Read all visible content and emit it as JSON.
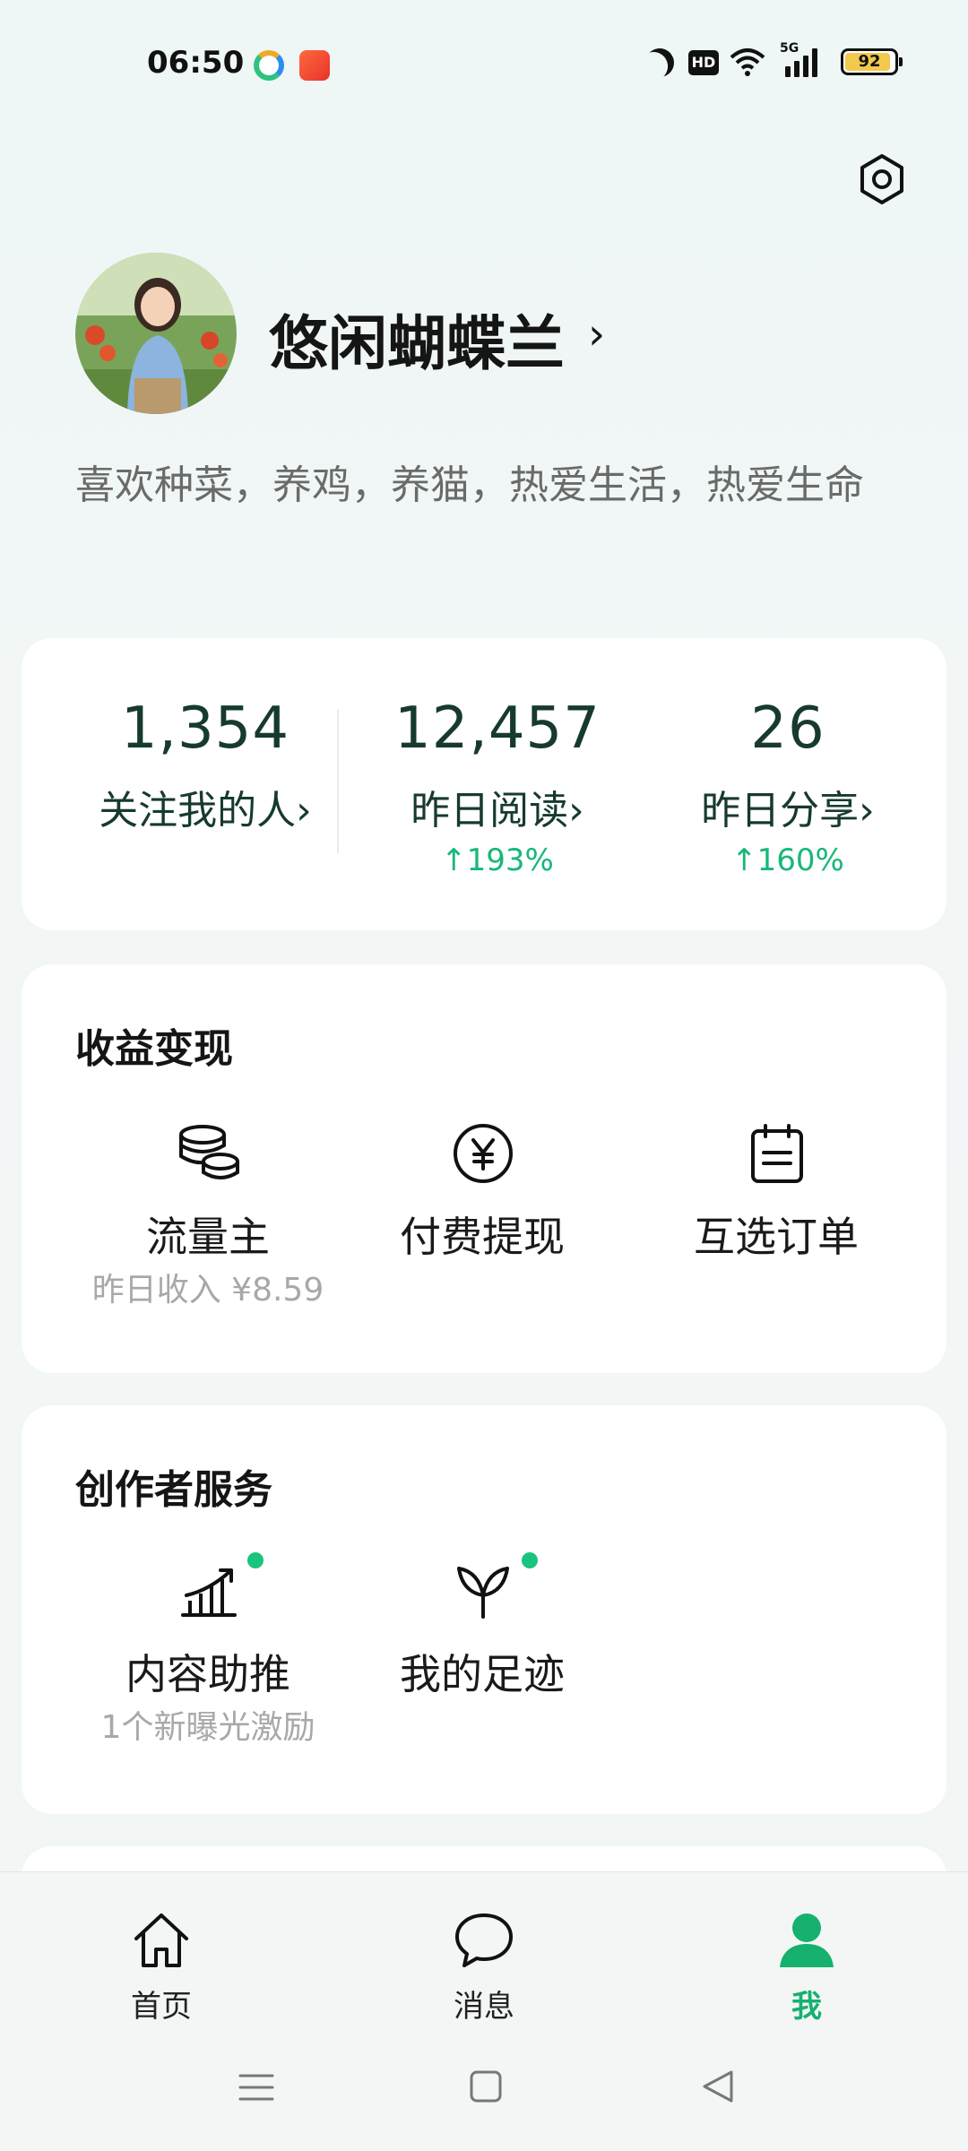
{
  "status_bar": {
    "time": "06:50",
    "battery": "92",
    "network": "5G"
  },
  "profile": {
    "name": "悠闲蝴蝶兰",
    "name_arrow": "›",
    "bio": "喜欢种菜，养鸡，养猫，热爱生活，热爱生命"
  },
  "stats": [
    {
      "value": "1,354",
      "label": "关注我的人›",
      "growth": ""
    },
    {
      "value": "12,457",
      "label": "昨日阅读›",
      "growth": "↑193%"
    },
    {
      "value": "26",
      "label": "昨日分享›",
      "growth": "↑160%"
    }
  ],
  "earnings": {
    "title": "收益变现",
    "items": [
      {
        "label": "流量主",
        "sub": "昨日收入 ¥8.59",
        "icon": "coins-icon"
      },
      {
        "label": "付费提现",
        "sub": "",
        "icon": "yen-icon"
      },
      {
        "label": "互选订单",
        "sub": "",
        "icon": "clipboard-icon"
      }
    ]
  },
  "creator": {
    "title": "创作者服务",
    "items": [
      {
        "label": "内容助推",
        "sub": "1个新曝光激励",
        "icon": "growth-chart-icon"
      },
      {
        "label": "我的足迹",
        "sub": "",
        "icon": "sprout-icon"
      }
    ]
  },
  "bottom_nav": {
    "items": [
      {
        "label": "首页",
        "icon": "home-icon"
      },
      {
        "label": "消息",
        "icon": "chat-bubble-icon"
      },
      {
        "label": "我",
        "icon": "person-icon",
        "active": true
      }
    ]
  },
  "colors": {
    "accent": "#16b06f",
    "growth": "#17b878",
    "stat_text": "#163a2e"
  }
}
